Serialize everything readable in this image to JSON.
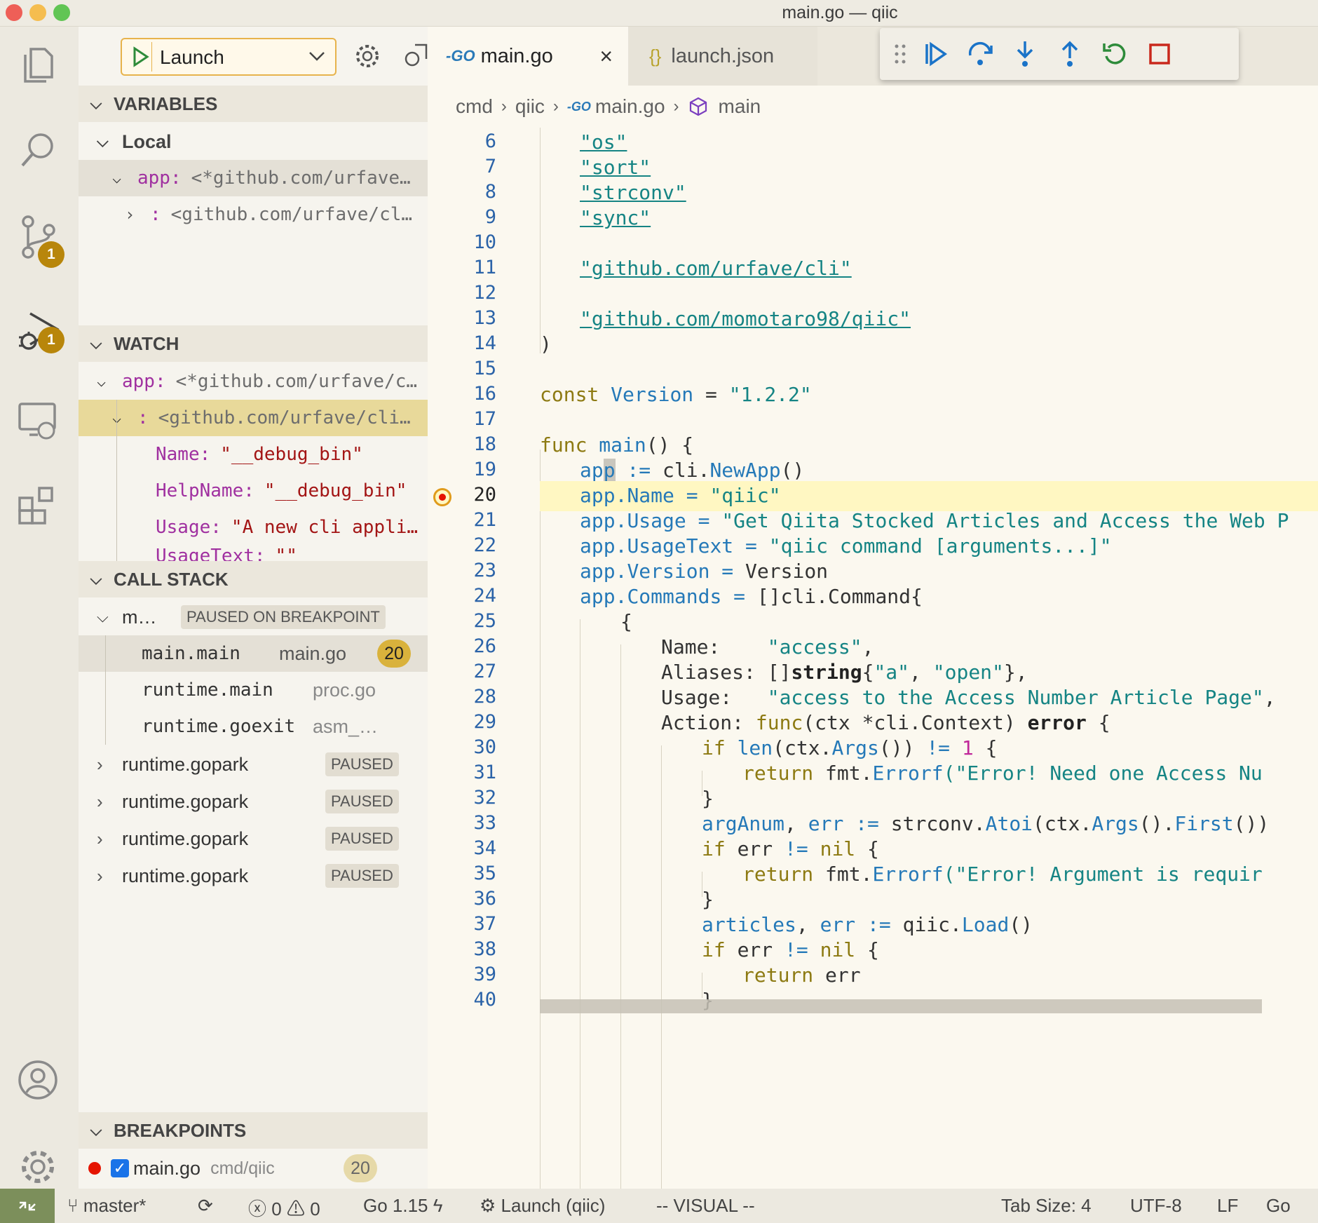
{
  "window": {
    "title": "main.go — qiic"
  },
  "activity_bar": {
    "scm_badge": "1",
    "debug_badge": "1"
  },
  "run": {
    "config_label": "Launch"
  },
  "variables": {
    "header": "VARIABLES",
    "local_label": "Local",
    "app_name": "app:",
    "app_value": "<*github.com/urfave…",
    "child_name": ":",
    "child_value": "<github.com/urfave/cl…"
  },
  "watch": {
    "header": "WATCH",
    "app_name": "app:",
    "app_value": "<*github.com/urfave/c…",
    "child_name": ":",
    "child_value": "<github.com/urfave/cli…",
    "fields": [
      {
        "name": "Name:",
        "value": "\"__debug_bin\""
      },
      {
        "name": "HelpName:",
        "value": "\"__debug_bin\""
      },
      {
        "name": "Usage:",
        "value": "\"A new cli appli…"
      },
      {
        "name": "UsageText:",
        "value": "\"\""
      }
    ]
  },
  "call_stack": {
    "header": "CALL STACK",
    "thread": "m…",
    "thread_status": "PAUSED ON BREAKPOINT",
    "frames": [
      {
        "fn": "main.main",
        "file": "main.go",
        "line": "20"
      },
      {
        "fn": "runtime.main",
        "file": "proc.go"
      },
      {
        "fn": "runtime.goexit",
        "file": "asm_…"
      }
    ],
    "other_threads": [
      {
        "name": "runtime.gopark",
        "status": "PAUSED"
      },
      {
        "name": "runtime.gopark",
        "status": "PAUSED"
      },
      {
        "name": "runtime.gopark",
        "status": "PAUSED"
      },
      {
        "name": "runtime.gopark",
        "status": "PAUSED"
      }
    ]
  },
  "breakpoints": {
    "header": "BREAKPOINTS",
    "items": [
      {
        "file": "main.go",
        "path": "cmd/qiic",
        "line": "20"
      }
    ]
  },
  "tabs": [
    {
      "icon": "-GO",
      "label": "main.go"
    },
    {
      "icon": "{}",
      "label": "launch.json"
    }
  ],
  "breadcrumbs": [
    "cmd",
    "qiic",
    "main.go",
    "main"
  ],
  "colors": {
    "accent_yellow": "#d9b23c",
    "breakpoint_red": "#e51400",
    "debug_blue": "#1a73c8",
    "debug_green": "#2e8b3a",
    "stop_red": "#c9281c"
  },
  "code": {
    "current_line": 20,
    "line_numbers": [
      "6",
      "7",
      "8",
      "9",
      "10",
      "11",
      "12",
      "13",
      "14",
      "15",
      "16",
      "17",
      "18",
      "19",
      "20",
      "21",
      "22",
      "23",
      "24",
      "25",
      "26",
      "27",
      "28",
      "29",
      "30",
      "31",
      "32",
      "33",
      "34",
      "35",
      "36",
      "37",
      "38",
      "39",
      "40"
    ],
    "l6": "\"os\"",
    "l7": "\"sort\"",
    "l8": "\"strconv\"",
    "l9": "\"sync\"",
    "l11": "\"github.com/urfave/cli\"",
    "l13": "\"github.com/momotaro98/qiic\"",
    "l14": ")",
    "l16_kw": "const",
    "l16_name": "Version",
    "l16_op": " = ",
    "l16_val": "\"1.2.2\"",
    "l18_kw": "func",
    "l18_name": "main",
    "l18_rest": "() {",
    "l19_a": "ap",
    "l19_b": "p",
    "l19_op": " := ",
    "l19_pkg": "cli.",
    "l19_fn": "NewApp",
    "l19_end": "()",
    "l20_obj": "app.",
    "l20_field": "Name",
    "l20_op": " = ",
    "l20_val": "\"qiic\"",
    "l21_obj": "app.",
    "l21_field": "Usage",
    "l21_op": " = ",
    "l21_val": "\"Get Qiita Stocked Articles and Access the Web P",
    "l22_obj": "app.",
    "l22_field": "UsageText",
    "l22_op": " = ",
    "l22_val": "\"qiic command [arguments...]\"",
    "l23_obj": "app.",
    "l23_field": "Version",
    "l23_op": " = ",
    "l23_val": "Version",
    "l24_obj": "app.",
    "l24_field": "Commands",
    "l24_op": " = ",
    "l24_val": "[]cli.Command{",
    "l25": "{",
    "l26_key": "Name:    ",
    "l26_val": "\"access\"",
    "l26_end": ",",
    "l27_key": "Aliases: []",
    "l27_type": "string",
    "l27_b": "{",
    "l27_v1": "\"a\"",
    "l27_sep": ", ",
    "l27_v2": "\"open\"",
    "l27_end": "},",
    "l28_key": "Usage:   ",
    "l28_val": "\"access to the Access Number Article Page\"",
    "l28_end": ",",
    "l29_key": "Action: ",
    "l29_kw": "func",
    "l29_mid": "(ctx *cli.Context) ",
    "l29_err": "error",
    "l29_end": " {",
    "l30_kw": "if",
    "l30_fn": "len",
    "l30_a": "(ctx.",
    "l30_args": "Args",
    "l30_b": "()) ",
    "l30_op": "!=",
    "l30_num": "1",
    "l30_end": " {",
    "l31_kw": "return",
    "l31_pkg": " fmt.",
    "l31_fn": "Errorf",
    "l31_str": "(\"Error! Need one Access Nu",
    "l32": "}",
    "l33_var": "argAnum",
    "l33_sep": ", ",
    "l33_err": "err",
    "l33_op": " := ",
    "l33_pkg": "strconv.",
    "l33_fn": "Atoi",
    "l33_a": "(ctx.",
    "l33_args": "Args",
    "l33_b": "().",
    "l33_first": "First",
    "l33_end": "())",
    "l34_kw": "if",
    "l34_mid": " err ",
    "l34_op": "!=",
    "l34_nil": "nil",
    "l34_end": " {",
    "l35_kw": "return",
    "l35_pkg": " fmt.",
    "l35_fn": "Errorf",
    "l35_str": "(\"Error! Argument is requir",
    "l36": "}",
    "l37_var": "articles",
    "l37_sep": ", ",
    "l37_err": "err",
    "l37_op": " := ",
    "l37_pkg": "qiic.",
    "l37_fn": "Load",
    "l37_end": "()",
    "l38_kw": "if",
    "l38_mid": " err ",
    "l38_op": "!=",
    "l38_nil": "nil",
    "l38_end": " {",
    "l39_kw": "return",
    "l39_rest": " err",
    "l40": "}"
  },
  "status_bar": {
    "branch": "master*",
    "errors": "0",
    "warnings": "0",
    "go_version": "Go 1.15",
    "launch": "Launch (qiic)",
    "mode": "-- VISUAL --",
    "tab_size": "Tab Size: 4",
    "encoding": "UTF-8",
    "eol": "LF",
    "language": "Go"
  }
}
